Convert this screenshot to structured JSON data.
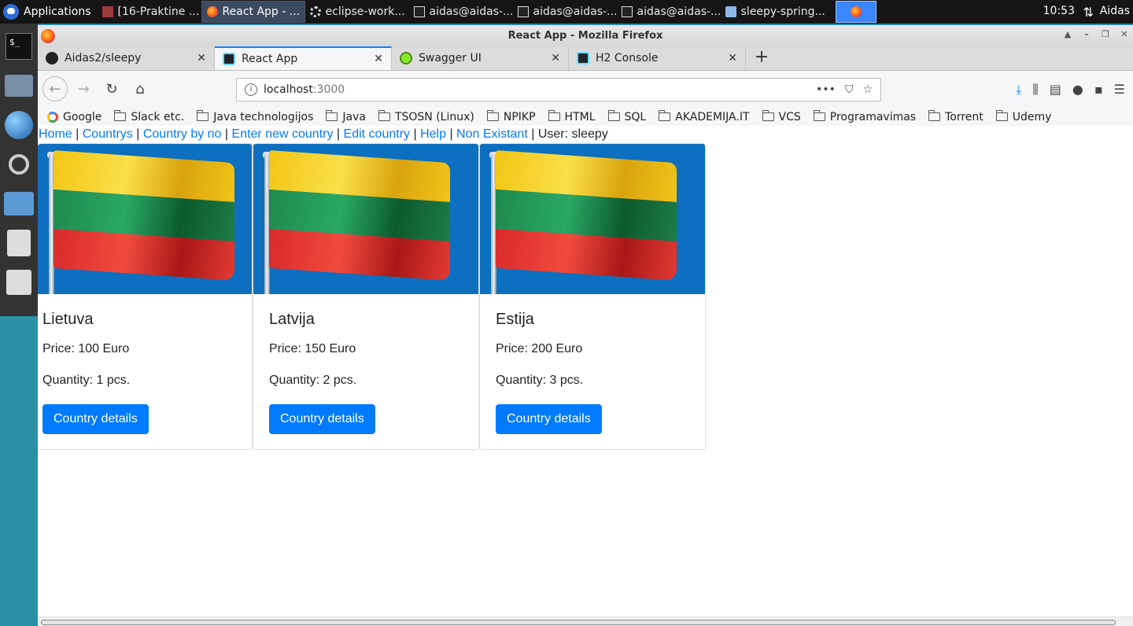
{
  "taskbar": {
    "applications_label": "Applications",
    "tasks": [
      {
        "label": "[16-Praktine ...",
        "icon": "document-icon"
      },
      {
        "label": "React App - ...",
        "icon": "firefox-icon",
        "active": true
      },
      {
        "label": "eclipse-work...",
        "icon": "eclipse-icon"
      },
      {
        "label": "aidas@aidas-...",
        "icon": "terminal-icon"
      },
      {
        "label": "aidas@aidas-...",
        "icon": "terminal-icon"
      },
      {
        "label": "aidas@aidas-...",
        "icon": "terminal-icon"
      },
      {
        "label": "sleepy-spring...",
        "icon": "folder-icon"
      }
    ],
    "clock": "10:53",
    "user": "Aidas"
  },
  "window": {
    "title": "React App - Mozilla Firefox"
  },
  "tabs": [
    {
      "label": "Aidas2/sleepy",
      "icon": "github-icon"
    },
    {
      "label": "React App",
      "icon": "react-icon",
      "active": true
    },
    {
      "label": "Swagger UI",
      "icon": "swagger-icon"
    },
    {
      "label": "H2 Console",
      "icon": "react-icon"
    }
  ],
  "urlbar": {
    "host": "localhost",
    "port": ":3000"
  },
  "bookmarks": [
    {
      "label": "Google",
      "icon": "google-icon"
    },
    {
      "label": "Slack etc.",
      "icon": "folder-icon"
    },
    {
      "label": "Java technologijos",
      "icon": "folder-icon"
    },
    {
      "label": "Java",
      "icon": "folder-icon"
    },
    {
      "label": "TSOSN (Linux)",
      "icon": "folder-icon"
    },
    {
      "label": "NPIKP",
      "icon": "folder-icon"
    },
    {
      "label": "HTML",
      "icon": "folder-icon"
    },
    {
      "label": "SQL",
      "icon": "folder-icon"
    },
    {
      "label": "AKADEMIJA.IT",
      "icon": "folder-icon"
    },
    {
      "label": "VCS",
      "icon": "folder-icon"
    },
    {
      "label": "Programavimas",
      "icon": "folder-icon"
    },
    {
      "label": "Torrent",
      "icon": "folder-icon"
    },
    {
      "label": "Udemy",
      "icon": "folder-icon"
    }
  ],
  "app_nav": {
    "links": [
      "Home",
      "Countrys",
      "Country by no",
      "Enter new country",
      "Edit country",
      "Help",
      "Non Existant"
    ],
    "user_text": "User: sleepy",
    "separator": "|"
  },
  "cards": [
    {
      "title": "Lietuva",
      "price": "Price: 100 Euro",
      "quantity": "Quantity: 1 pcs.",
      "button": "Country details"
    },
    {
      "title": "Latvija",
      "price": "Price: 150 Euro",
      "quantity": "Quantity: 2 pcs.",
      "button": "Country details"
    },
    {
      "title": "Estija",
      "price": "Price: 200 Euro",
      "quantity": "Quantity: 3 pcs.",
      "button": "Country details"
    }
  ],
  "colors": {
    "link": "#007bff",
    "button": "#007bff",
    "flag_sky": "#0d6fbf"
  }
}
